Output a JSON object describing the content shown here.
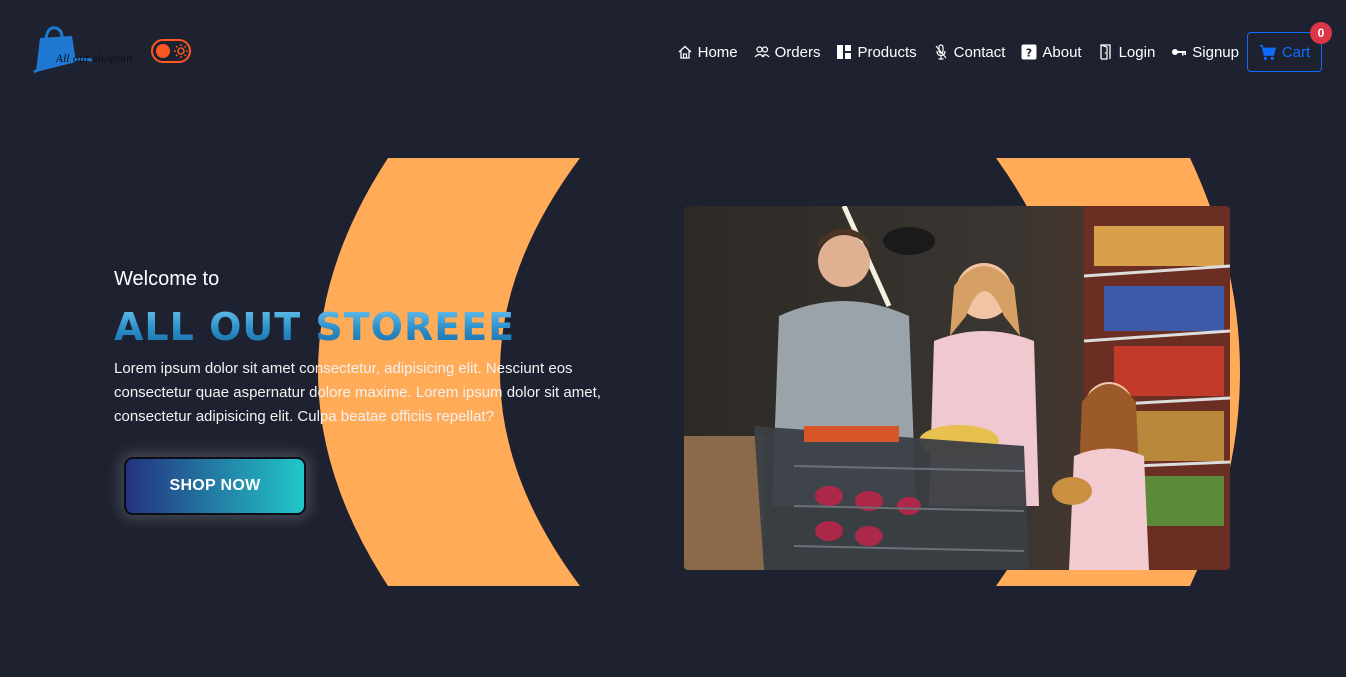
{
  "logo": {
    "text": "All out shopping"
  },
  "nav": {
    "items": [
      {
        "label": "Home",
        "icon": "home-icon"
      },
      {
        "label": "Orders",
        "icon": "people-icon"
      },
      {
        "label": "Products",
        "icon": "grid-icon"
      },
      {
        "label": "Contact",
        "icon": "microphone-icon"
      },
      {
        "label": "About",
        "icon": "question-icon"
      },
      {
        "label": "Login",
        "icon": "door-icon"
      },
      {
        "label": "Signup",
        "icon": "key-icon"
      }
    ],
    "cart": {
      "label": "Cart",
      "count": "0",
      "icon": "cart-icon"
    }
  },
  "hero": {
    "welcome": "Welcome to",
    "title": "ALL OUT STOREEE",
    "description": "Lorem ipsum dolor sit amet consectetur, adipisicing elit. Nesciunt eos consectetur quae aspernatur dolore maxime. Lorem ipsum dolor sit amet, consectetur adipisicing elit. Culpa beatae officiis repellat?",
    "button": "SHOP NOW"
  },
  "colors": {
    "background": "#1e2230",
    "accent_orange": "#ffab57",
    "toggle": "#ff5722",
    "cart_blue": "#0d6efd",
    "badge_red": "#dc3545"
  }
}
